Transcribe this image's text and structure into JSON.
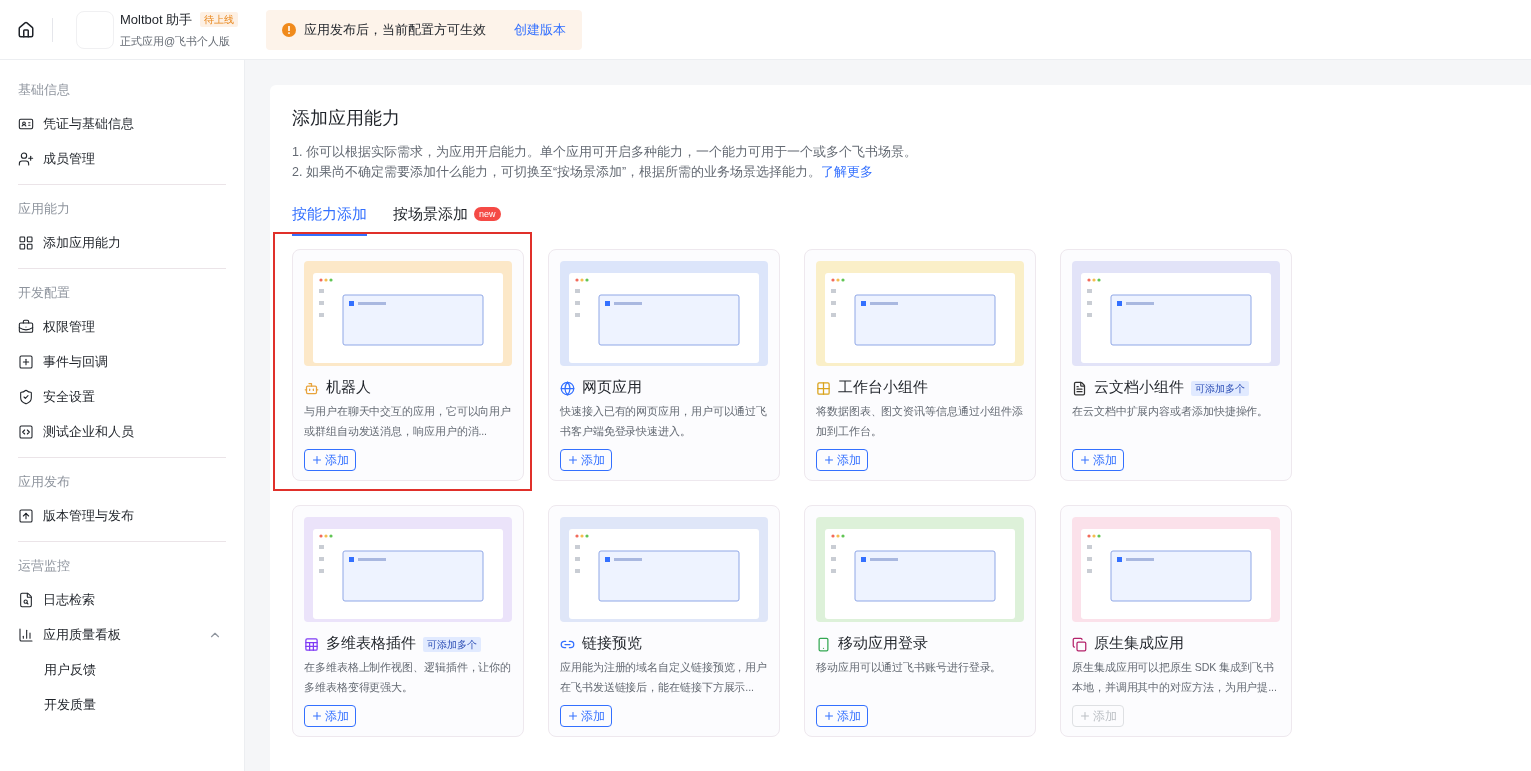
{
  "header": {
    "app_name": "Moltbot 助手",
    "status_badge": "待上线",
    "subtitle": "正式应用@飞书个人版",
    "notice": "应用发布后，当前配置方可生效",
    "notice_link": "创建版本"
  },
  "sidebar": [
    {
      "title": "基础信息",
      "items": [
        {
          "label": "凭证与基础信息",
          "selected": false
        },
        {
          "label": "成员管理",
          "selected": false
        }
      ]
    },
    {
      "title": "应用能力",
      "items": [
        {
          "label": "添加应用能力",
          "selected": false
        }
      ]
    },
    {
      "title": "开发配置",
      "items": [
        {
          "label": "权限管理",
          "selected": false
        },
        {
          "label": "事件与回调",
          "selected": false
        },
        {
          "label": "安全设置",
          "selected": false
        },
        {
          "label": "测试企业和人员",
          "selected": false
        }
      ]
    },
    {
      "title": "应用发布",
      "items": [
        {
          "label": "版本管理与发布",
          "selected": false
        }
      ]
    },
    {
      "title": "运营监控",
      "items": [
        {
          "label": "日志检索",
          "selected": false
        },
        {
          "label": "应用质量看板",
          "selected": false,
          "expanded": true,
          "children": [
            {
              "label": "用户反馈",
              "selected": false
            },
            {
              "label": "开发质量",
              "selected": false
            }
          ]
        }
      ]
    }
  ],
  "page": {
    "title": "添加应用能力",
    "notes": [
      "1. 你可以根据实际需求，为应用开启能力。单个应用可开启多种能力，一个能力可用于一个或多个飞书场景。",
      "2. 如果尚不确定需要添加什么能力，可切换至“按场景添加”，根据所需的业务场景选择能力。"
    ],
    "learn_more": "了解更多",
    "tabs": [
      {
        "label": "按能力添加",
        "selected": true
      },
      {
        "label": "按场景添加",
        "selected": false,
        "badge": "new"
      }
    ],
    "cards": [
      {
        "title": "机器人",
        "description": "与用户在聊天中交互的应用，它可以向用户或群组自动发送消息，响应用户的消...",
        "add": "添加",
        "color": "#fce8c8",
        "highlighted": true,
        "disabled": false
      },
      {
        "title": "网页应用",
        "description": "快速接入已有的网页应用，用户可以通过飞书客户端免登录快速进入。",
        "add": "添加",
        "color": "#dce5fa",
        "highlighted": false,
        "disabled": false
      },
      {
        "title": "工作台小组件",
        "description": "将数据图表、图文资讯等信息通过小组件添加到工作台。",
        "add": "添加",
        "color": "#faefc8",
        "highlighted": false,
        "disabled": false
      },
      {
        "title": "云文档小组件",
        "tag": "可添加多个",
        "description": "在云文档中扩展内容或者添加快捷操作。",
        "add": "添加",
        "color": "#e2e3f8",
        "highlighted": false,
        "disabled": false
      },
      {
        "title": "多维表格插件",
        "tag": "可添加多个",
        "description": "在多维表格上制作视图、逻辑插件，让你的多维表格变得更强大。",
        "add": "添加",
        "color": "#ebe3fa",
        "highlighted": false,
        "disabled": false
      },
      {
        "title": "链接预览",
        "description": "应用能为注册的域名自定义链接预览，用户在飞书发送链接后，能在链接下方展示...",
        "add": "添加",
        "color": "#dfe6f8",
        "highlighted": false,
        "disabled": false
      },
      {
        "title": "移动应用登录",
        "description": "移动应用可以通过飞书账号进行登录。",
        "add": "添加",
        "color": "#ddf1d9",
        "highlighted": false,
        "disabled": false
      },
      {
        "title": "原生集成应用",
        "description": "原生集成应用可以把原生 SDK 集成到飞书本地，并调用其中的对应方法，为用户提...",
        "add": "添加",
        "color": "#fbe1ea",
        "highlighted": false,
        "disabled": true
      }
    ]
  }
}
